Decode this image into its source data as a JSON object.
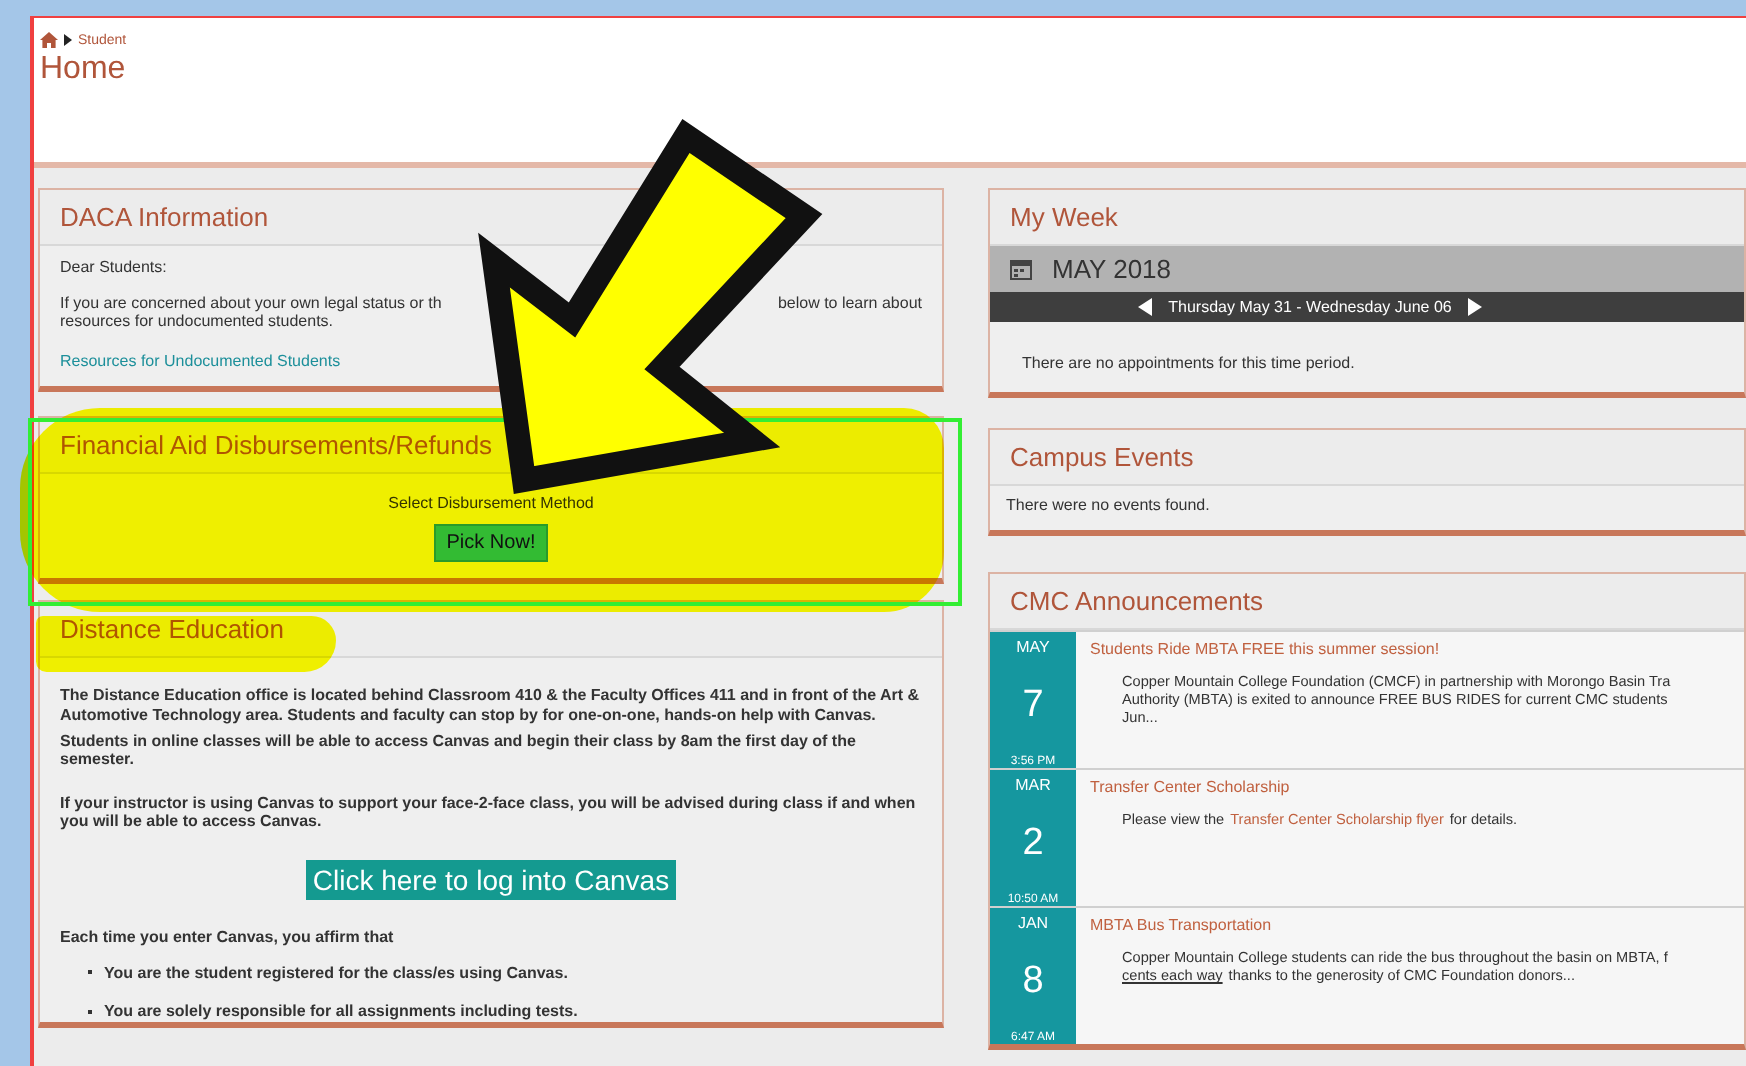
{
  "breadcrumb": {
    "items": [
      "Student"
    ]
  },
  "page_title": "Home",
  "daca": {
    "title": "DACA Information",
    "greeting": "Dear Students:",
    "text_before": "If you are concerned about your own legal status or th",
    "text_after": "below to learn about",
    "text_line2": "resources for undocumented students.",
    "link": "Resources for Undocumented Students"
  },
  "financial_aid": {
    "title": "Financial Aid Disbursements/Refunds",
    "prompt": "Select Disbursement Method",
    "button": "Pick Now!"
  },
  "distance_education": {
    "title": "Distance Education",
    "paragraphs": [
      "The Distance Education office is located behind Classroom 410 & the Faculty Offices 411 and in front of the Art & Automotive Technology area. Students and faculty can stop by for one-on-one, hands-on help with Canvas.",
      "Students in online classes will be able to access Canvas and begin their class by 8am the first day of the semester.",
      "If your instructor is using Canvas to support your face-2-face class, you will be advised during class if and when you will be able to access Canvas."
    ],
    "button": "Click here to log into Canvas",
    "affirm": "Each time you enter Canvas, you affirm that",
    "bullets": [
      "You are the student registered for the class/es using Canvas.",
      "You are solely responsible for all assignments including tests."
    ]
  },
  "my_week": {
    "title": "My Week",
    "month": "MAY 2018",
    "range": "Thursday May 31 - Wednesday June 06",
    "empty": "There are no appointments for this time period."
  },
  "campus_events": {
    "title": "Campus Events",
    "empty": "There were no events found."
  },
  "announcements": {
    "title": "CMC Announcements",
    "items": [
      {
        "month": "MAY",
        "day": "7",
        "time": "3:56 PM",
        "title": "Students Ride MBTA FREE this summer session!",
        "lines": [
          [
            {
              "kind": "text",
              "text": "Copper Mountain College Foundation (CMCF) in partnership with Morongo Basin Tra"
            }
          ],
          [
            {
              "kind": "text",
              "text": "Authority (MBTA) is exited to announce FREE BUS RIDES for current CMC students"
            }
          ],
          [
            {
              "kind": "text",
              "text": "Jun..."
            }
          ]
        ]
      },
      {
        "month": "MAR",
        "day": "2",
        "time": "10:50 AM",
        "title": "Transfer Center Scholarship",
        "lines": [
          [
            {
              "kind": "text",
              "text": "Please view the"
            },
            {
              "kind": "link",
              "text": "Transfer Center Scholarship flyer"
            },
            {
              "kind": "text",
              "text": "for details."
            }
          ]
        ]
      },
      {
        "month": "JAN",
        "day": "8",
        "time": "6:47 AM",
        "title": "MBTA Bus Transportation",
        "lines": [
          [
            {
              "kind": "text",
              "text": "Copper Mountain College students can ride the bus throughout the basin on MBTA, f"
            }
          ],
          [
            {
              "kind": "underline",
              "text": "cents each way"
            },
            {
              "kind": "text",
              "text": "thanks to the generosity of CMC Foundation donors..."
            }
          ]
        ]
      }
    ]
  }
}
